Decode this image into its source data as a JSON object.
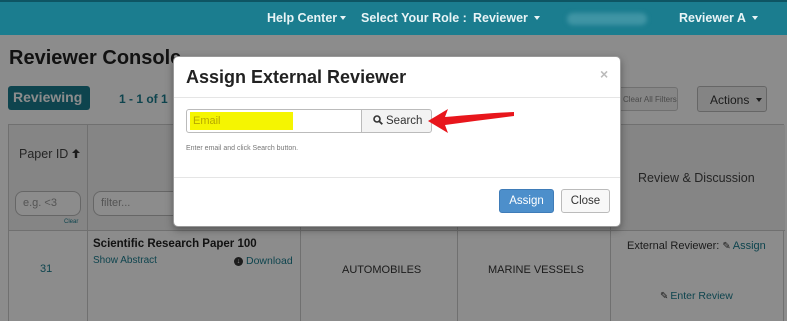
{
  "navbar": {
    "help_center": "Help Center",
    "select_role_label": "Select Your Role :",
    "role_value": "Reviewer",
    "user_menu": "Reviewer A"
  },
  "page": {
    "title": "Reviewer Console",
    "reviewing_tab": "Reviewing",
    "pager": "1 - 1 of 1",
    "clear_filters": "Clear All Filters",
    "actions_label": "Actions"
  },
  "table": {
    "headers": {
      "paper_id": "Paper ID",
      "review_discussion": "Review & Discussion"
    },
    "filters": {
      "paper_id_placeholder": "e.g. <3",
      "clear": "Clear",
      "title_placeholder": "filter..."
    },
    "rows": [
      {
        "paper_id": "31",
        "title": "Scientific Research Paper 100",
        "show_abstract": "Show Abstract",
        "download": "Download",
        "subject_1": "AUTOMOBILES",
        "subject_2": "MARINE VESSELS",
        "external_reviewer_label": "External Reviewer:",
        "assign_link": "Assign",
        "enter_review": "Enter Review"
      }
    ]
  },
  "modal": {
    "title": "Assign External Reviewer",
    "close_glyph": "×",
    "email_placeholder": "Email",
    "search_label": "Search",
    "helper_text": "Enter email and click Search button.",
    "assign_label": "Assign",
    "close_label": "Close"
  },
  "colors": {
    "brand": "#1b7d8f",
    "primary_button": "#4d8fcb",
    "highlight": "#f5f501",
    "annotation_arrow": "#e8161c"
  },
  "icons": {
    "search": "search-icon",
    "download": "download-icon",
    "edit": "edit-icon",
    "sort": "sort-up-icon",
    "arrow": "red-arrow-annotation"
  }
}
